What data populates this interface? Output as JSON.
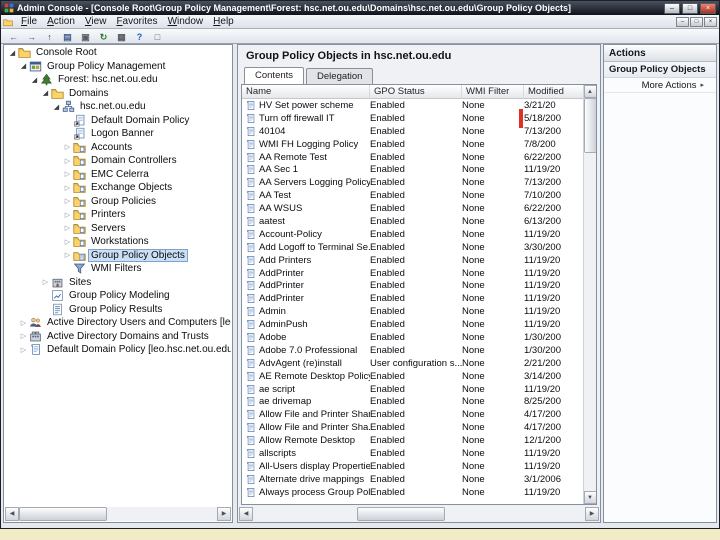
{
  "window": {
    "title": "Admin Console - [Console Root\\Group Policy Management\\Forest: hsc.net.ou.edu\\Domains\\hsc.net.ou.edu\\Group Policy Objects]",
    "controls": {
      "minimize": "–",
      "maximize": "□",
      "close": "×"
    }
  },
  "menu": {
    "items": [
      {
        "name": "menu-file",
        "label": "File"
      },
      {
        "name": "menu-action",
        "label": "Action"
      },
      {
        "name": "menu-view",
        "label": "View"
      },
      {
        "name": "menu-favorites",
        "label": "Favorites"
      },
      {
        "name": "menu-window",
        "label": "Window"
      },
      {
        "name": "menu-help",
        "label": "Help"
      }
    ]
  },
  "toolbar": {
    "buttons": [
      {
        "name": "back-button",
        "glyph": "←",
        "color": "#2458a8"
      },
      {
        "name": "forward-button",
        "glyph": "→",
        "color": "#2458a8"
      },
      {
        "name": "up-one-level-button",
        "glyph": "↑",
        "color": "#3a3f46"
      },
      {
        "name": "show-console-tree-button",
        "glyph": "▤",
        "color": "#44608e"
      },
      {
        "name": "properties-button",
        "glyph": "▣",
        "color": "#5a5f66"
      },
      {
        "name": "refresh-button",
        "glyph": "↻",
        "color": "#2f7a35"
      },
      {
        "name": "export-list-button",
        "glyph": "▦",
        "color": "#5a5f66"
      },
      {
        "name": "help-button",
        "glyph": "?",
        "color": "#1f5fbe"
      },
      {
        "name": "new-window-button",
        "glyph": "□",
        "color": "#5a5f66"
      }
    ]
  },
  "tree": {
    "items": [
      {
        "name": "tree-item-console-root",
        "label": "Console Root",
        "level": 0,
        "icon": "folder",
        "expander": "minus"
      },
      {
        "name": "tree-item-group-policy-management",
        "label": "Group Policy Management",
        "level": 1,
        "icon": "gpm",
        "expander": "minus"
      },
      {
        "name": "tree-item-forest",
        "label": "Forest: hsc.net.ou.edu",
        "level": 2,
        "icon": "forest",
        "expander": "minus"
      },
      {
        "name": "tree-item-domains",
        "label": "Domains",
        "level": 3,
        "icon": "domains",
        "expander": "minus"
      },
      {
        "name": "tree-item-domain-hsc",
        "label": "hsc.net.ou.edu",
        "level": 4,
        "icon": "domain",
        "expander": "minus"
      },
      {
        "name": "tree-item-default-domain-policy",
        "label": "Default Domain Policy",
        "level": 5,
        "icon": "gpolink",
        "expander": "none"
      },
      {
        "name": "tree-item-logon-banner",
        "label": "Logon Banner",
        "level": 5,
        "icon": "gpolink",
        "expander": "none"
      },
      {
        "name": "tree-item-accounts",
        "label": "Accounts",
        "level": 5,
        "icon": "ou",
        "expander": "plus"
      },
      {
        "name": "tree-item-domain-controllers",
        "label": "Domain Controllers",
        "level": 5,
        "icon": "ou",
        "expander": "plus"
      },
      {
        "name": "tree-item-emc-celerra",
        "label": "EMC Celerra",
        "level": 5,
        "icon": "ou",
        "expander": "plus"
      },
      {
        "name": "tree-item-exchange-objects",
        "label": "Exchange Objects",
        "level": 5,
        "icon": "ou",
        "expander": "plus"
      },
      {
        "name": "tree-item-group-policies",
        "label": "Group Policies",
        "level": 5,
        "icon": "ou",
        "expander": "plus"
      },
      {
        "name": "tree-item-printers",
        "label": "Printers",
        "level": 5,
        "icon": "ou",
        "expander": "plus"
      },
      {
        "name": "tree-item-servers",
        "label": "Servers",
        "level": 5,
        "icon": "ou",
        "expander": "plus"
      },
      {
        "name": "tree-item-workstations",
        "label": "Workstations",
        "level": 5,
        "icon": "ou",
        "expander": "plus"
      },
      {
        "name": "tree-item-group-policy-objects",
        "label": "Group Policy Objects",
        "level": 5,
        "icon": "gpofolder",
        "expander": "plus",
        "selected": true
      },
      {
        "name": "tree-item-wmi-filters",
        "label": "WMI Filters",
        "level": 5,
        "icon": "filter",
        "expander": "none"
      },
      {
        "name": "tree-item-sites",
        "label": "Sites",
        "level": 3,
        "icon": "sites",
        "expander": "plus"
      },
      {
        "name": "tree-item-group-policy-modeling",
        "label": "Group Policy Modeling",
        "level": 3,
        "icon": "modeling",
        "expander": "none"
      },
      {
        "name": "tree-item-group-policy-results",
        "label": "Group Policy Results",
        "level": 3,
        "icon": "results",
        "expander": "none"
      },
      {
        "name": "tree-item-ad-users-and-computers",
        "label": "Active Directory Users and Computers [leo.hsc.net.ou.edu]",
        "level": 1,
        "icon": "adusers",
        "expander": "plus"
      },
      {
        "name": "tree-item-ad-domains-and-trusts",
        "label": "Active Directory Domains and Trusts",
        "level": 1,
        "icon": "addomains",
        "expander": "plus"
      },
      {
        "name": "tree-item-default-domain-policy-editor",
        "label": "Default Domain Policy [leo.hsc.net.ou.edu] Policy",
        "level": 1,
        "icon": "policy",
        "expander": "plus"
      }
    ]
  },
  "content": {
    "title": "Group Policy Objects in hsc.net.ou.edu",
    "tabs": [
      {
        "name": "tab-contents",
        "label": "Contents"
      },
      {
        "name": "tab-delegation",
        "label": "Delegation"
      }
    ],
    "columns": [
      "Name",
      "GPO Status",
      "WMI Filter",
      "Modified"
    ],
    "rows": [
      {
        "name": "HV Set power scheme",
        "status": "Enabled",
        "wmi": "None",
        "modified": "3/21/20"
      },
      {
        "name": "Turn off firewall IT",
        "status": "Enabled",
        "wmi": "None",
        "modified": "5/18/200"
      },
      {
        "name": "40104",
        "status": "Enabled",
        "wmi": "None",
        "modified": "7/13/200"
      },
      {
        "name": "WMI FH Logging Policy",
        "status": "Enabled",
        "wmi": "None",
        "modified": "7/8/200"
      },
      {
        "name": "AA Remote Test",
        "status": "Enabled",
        "wmi": "None",
        "modified": "6/22/200"
      },
      {
        "name": "AA Sec 1",
        "status": "Enabled",
        "wmi": "None",
        "modified": "11/19/20"
      },
      {
        "name": "AA Servers Logging Policy",
        "status": "Enabled",
        "wmi": "None",
        "modified": "7/13/200"
      },
      {
        "name": "AA Test",
        "status": "Enabled",
        "wmi": "None",
        "modified": "7/10/200"
      },
      {
        "name": "AA WSUS",
        "status": "Enabled",
        "wmi": "None",
        "modified": "6/22/200"
      },
      {
        "name": "aatest",
        "status": "Enabled",
        "wmi": "None",
        "modified": "6/13/200"
      },
      {
        "name": "Account-Policy",
        "status": "Enabled",
        "wmi": "None",
        "modified": "11/19/20"
      },
      {
        "name": "Add Logoff to Terminal Se...",
        "status": "Enabled",
        "wmi": "None",
        "modified": "3/30/200"
      },
      {
        "name": "Add Printers",
        "status": "Enabled",
        "wmi": "None",
        "modified": "11/19/20"
      },
      {
        "name": "AddPrinter",
        "status": "Enabled",
        "wmi": "None",
        "modified": "11/19/20"
      },
      {
        "name": "AddPrinter",
        "status": "Enabled",
        "wmi": "None",
        "modified": "11/19/20"
      },
      {
        "name": "AddPrinter",
        "status": "Enabled",
        "wmi": "None",
        "modified": "11/19/20"
      },
      {
        "name": "Admin",
        "status": "Enabled",
        "wmi": "None",
        "modified": "11/19/20"
      },
      {
        "name": "AdminPush",
        "status": "Enabled",
        "wmi": "None",
        "modified": "11/19/20"
      },
      {
        "name": "Adobe",
        "status": "Enabled",
        "wmi": "None",
        "modified": "1/30/200"
      },
      {
        "name": "Adobe 7.0 Professional",
        "status": "Enabled",
        "wmi": "None",
        "modified": "1/30/200"
      },
      {
        "name": "AdvAgent (re)install",
        "status": "User configuration s...",
        "wmi": "None",
        "modified": "2/21/200"
      },
      {
        "name": "AE Remote Desktop Policy",
        "status": "Enabled",
        "wmi": "None",
        "modified": "3/14/200"
      },
      {
        "name": "ae script",
        "status": "Enabled",
        "wmi": "None",
        "modified": "11/19/20"
      },
      {
        "name": "ae drivemap",
        "status": "Enabled",
        "wmi": "None",
        "modified": "8/25/200"
      },
      {
        "name": "Allow File and Printer Shar...",
        "status": "Enabled",
        "wmi": "None",
        "modified": "4/17/200"
      },
      {
        "name": "Allow File and Printer Sha...",
        "status": "Enabled",
        "wmi": "None",
        "modified": "4/17/200"
      },
      {
        "name": "Allow Remote Desktop",
        "status": "Enabled",
        "wmi": "None",
        "modified": "12/1/200"
      },
      {
        "name": "allscripts",
        "status": "Enabled",
        "wmi": "None",
        "modified": "11/19/20"
      },
      {
        "name": "All-Users display Properties",
        "status": "Enabled",
        "wmi": "None",
        "modified": "11/19/20"
      },
      {
        "name": "Alternate drive mappings",
        "status": "Enabled",
        "wmi": "None",
        "modified": "3/1/2006"
      },
      {
        "name": "Always process Group Pol...",
        "status": "Enabled",
        "wmi": "None",
        "modified": "11/19/20"
      }
    ]
  },
  "actions": {
    "title": "Actions",
    "section_label": "Group Policy Objects",
    "more_label": "More Actions"
  }
}
